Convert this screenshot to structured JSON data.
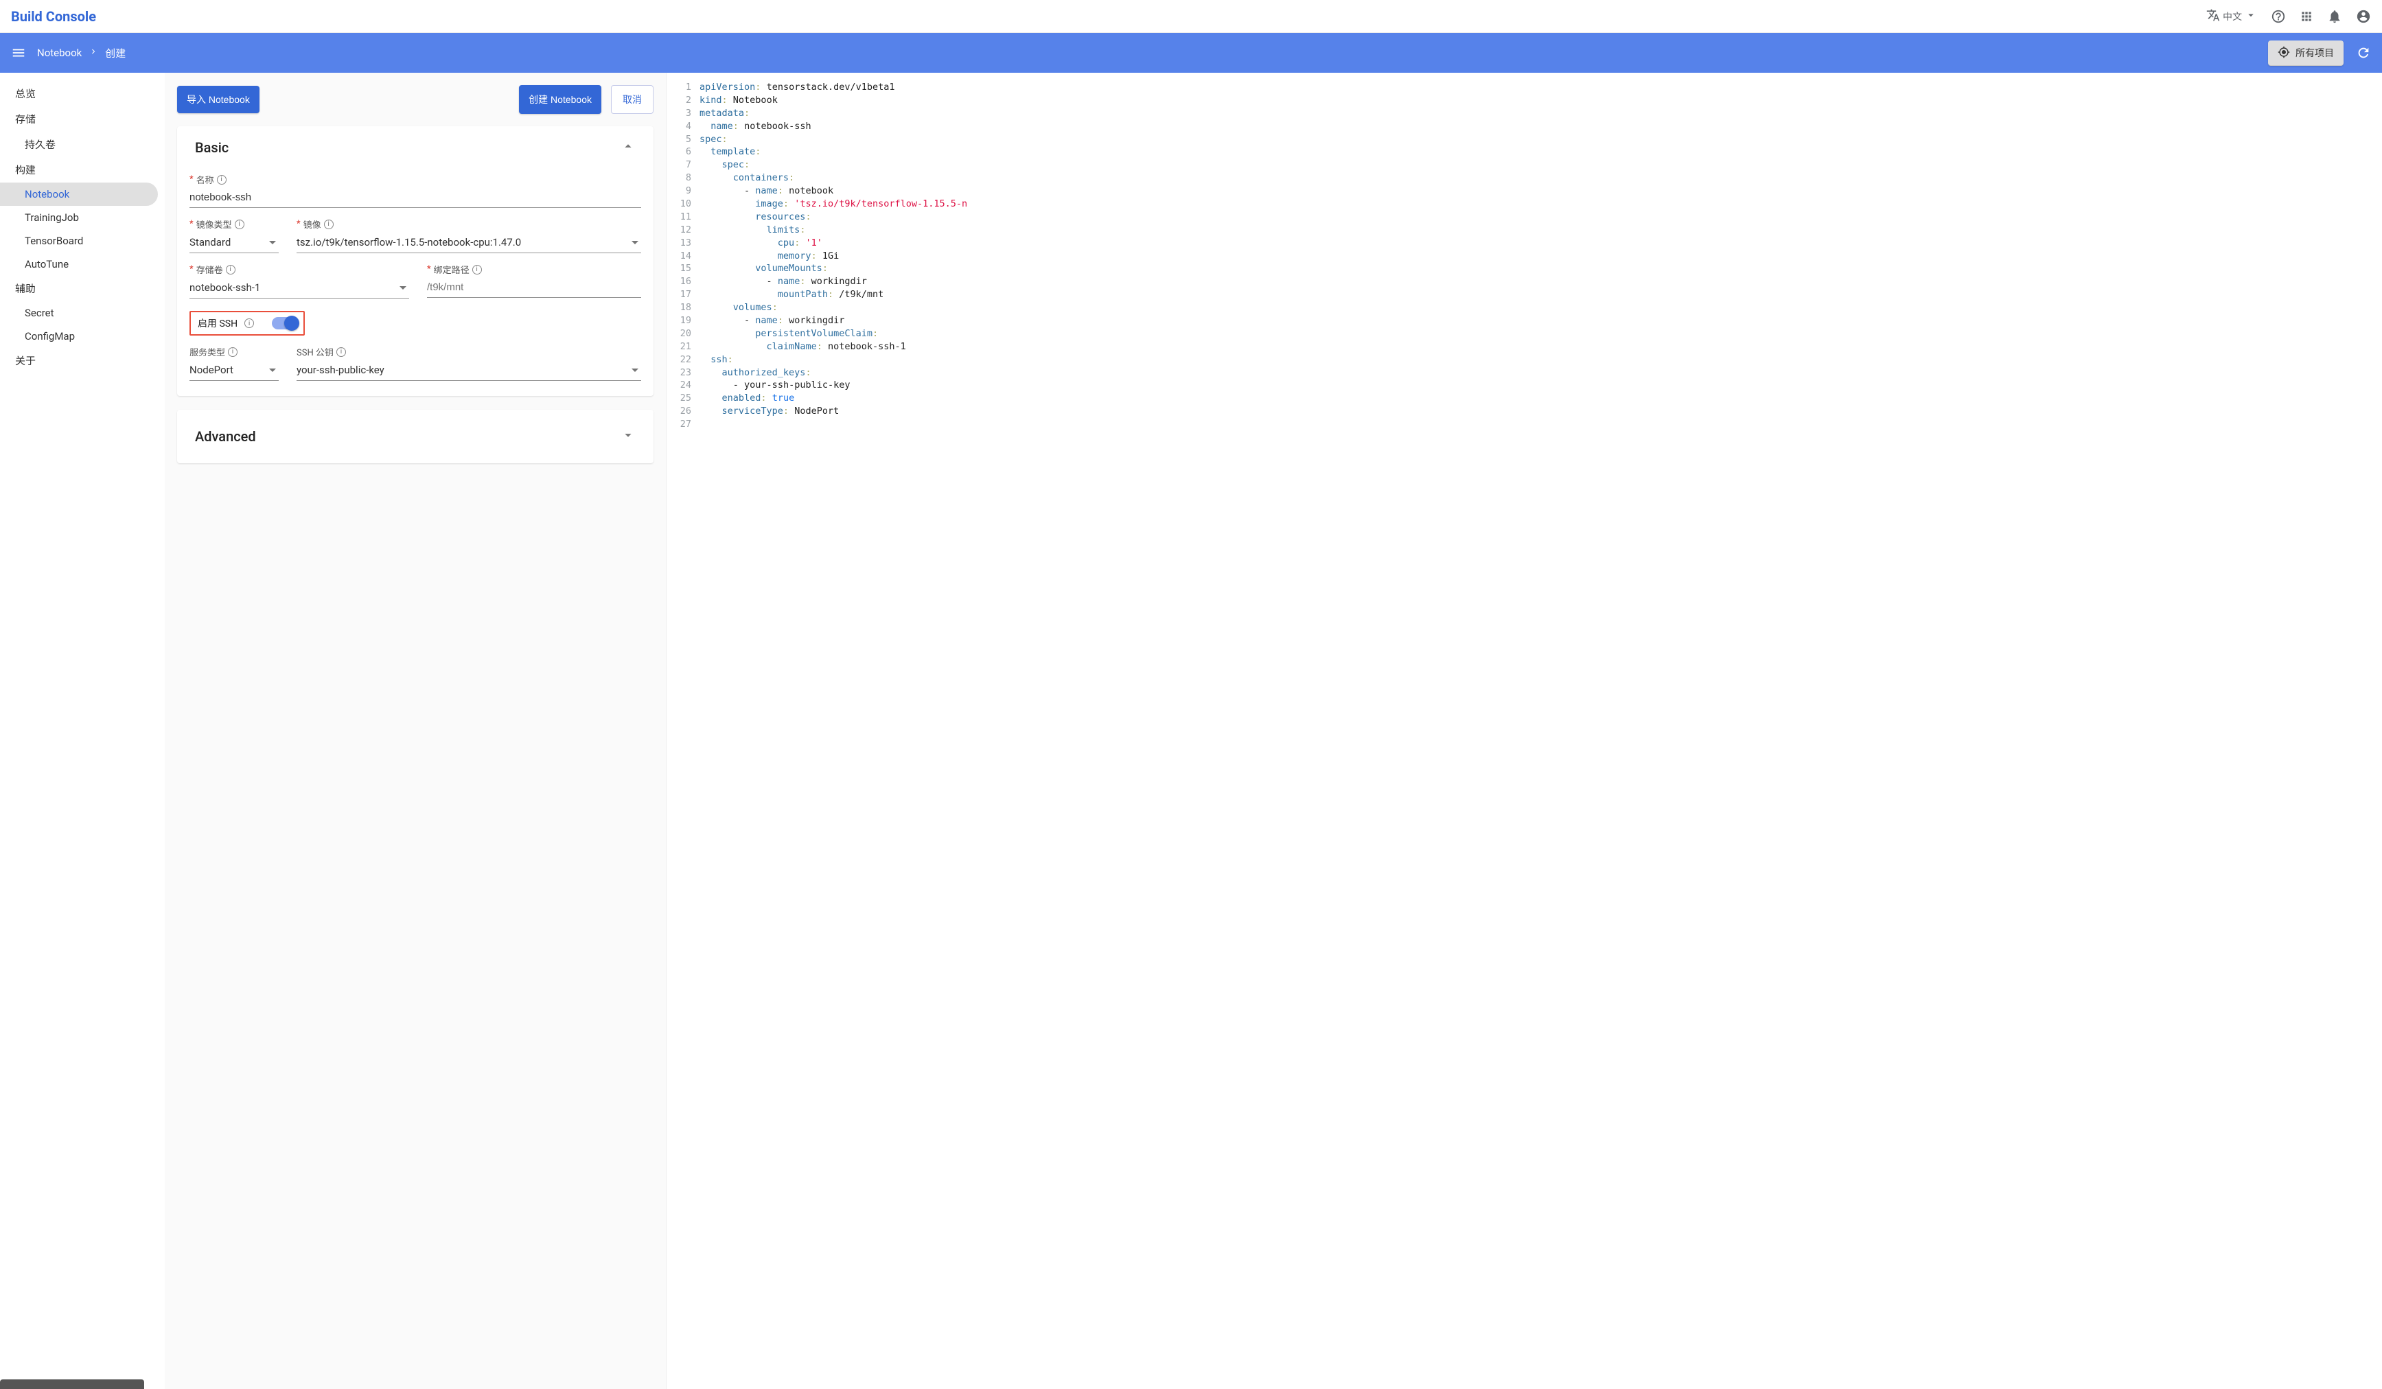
{
  "brand": "Build Console",
  "lang_label": "中文",
  "breadcrumb": {
    "a": "Notebook",
    "b": "创建"
  },
  "all_projects_label": "所有项目",
  "sidebar": {
    "overview": "总览",
    "storage": "存储",
    "pvc": "持久卷",
    "build": "构建",
    "notebook": "Notebook",
    "trainingjob": "TrainingJob",
    "tensorboard": "TensorBoard",
    "autotune": "AutoTune",
    "assist": "辅助",
    "secret": "Secret",
    "configmap": "ConfigMap",
    "about": "关于"
  },
  "actions": {
    "import": "导入 Notebook",
    "create": "创建 Notebook",
    "cancel": "取消"
  },
  "basic": {
    "title": "Basic",
    "name_label": "名称",
    "name_value": "notebook-ssh",
    "image_type_label": "镜像类型",
    "image_type_value": "Standard",
    "image_label": "镜像",
    "image_value": "tsz.io/t9k/tensorflow-1.15.5-notebook-cpu:1.47.0",
    "volume_label": "存储卷",
    "volume_value": "notebook-ssh-1",
    "mount_label": "绑定路径",
    "mount_placeholder": "/t9k/mnt",
    "enable_ssh_label": "启用 SSH",
    "service_type_label": "服务类型",
    "service_type_value": "NodePort",
    "ssh_pubkey_label": "SSH 公钥",
    "ssh_pubkey_value": "your-ssh-public-key"
  },
  "advanced": {
    "title": "Advanced"
  },
  "yaml": {
    "lines": [
      [
        [
          "key",
          "apiVersion"
        ],
        [
          "p",
          ":"
        ],
        [
          "s",
          " "
        ],
        [
          "plain",
          "tensorstack.dev/v1beta1"
        ]
      ],
      [
        [
          "key",
          "kind"
        ],
        [
          "p",
          ":"
        ],
        [
          "s",
          " "
        ],
        [
          "plain",
          "Notebook"
        ]
      ],
      [
        [
          "key",
          "metadata"
        ],
        [
          "p",
          ":"
        ]
      ],
      [
        [
          "i",
          "  "
        ],
        [
          "key",
          "name"
        ],
        [
          "p",
          ":"
        ],
        [
          "s",
          " "
        ],
        [
          "plain",
          "notebook-ssh"
        ]
      ],
      [
        [
          "key",
          "spec"
        ],
        [
          "p",
          ":"
        ]
      ],
      [
        [
          "i",
          "  "
        ],
        [
          "key",
          "template"
        ],
        [
          "p",
          ":"
        ]
      ],
      [
        [
          "i",
          "    "
        ],
        [
          "key",
          "spec"
        ],
        [
          "p",
          ":"
        ]
      ],
      [
        [
          "i",
          "      "
        ],
        [
          "key",
          "containers"
        ],
        [
          "p",
          ":"
        ]
      ],
      [
        [
          "i",
          "        "
        ],
        [
          "plain",
          "- "
        ],
        [
          "key",
          "name"
        ],
        [
          "p",
          ":"
        ],
        [
          "s",
          " "
        ],
        [
          "plain",
          "notebook"
        ]
      ],
      [
        [
          "i",
          "          "
        ],
        [
          "key",
          "image"
        ],
        [
          "p",
          ":"
        ],
        [
          "s",
          " "
        ],
        [
          "str",
          "'tsz.io/t9k/tensorflow-1.15.5-n"
        ]
      ],
      [
        [
          "i",
          "          "
        ],
        [
          "key",
          "resources"
        ],
        [
          "p",
          ":"
        ]
      ],
      [
        [
          "i",
          "            "
        ],
        [
          "key",
          "limits"
        ],
        [
          "p",
          ":"
        ]
      ],
      [
        [
          "i",
          "              "
        ],
        [
          "key",
          "cpu"
        ],
        [
          "p",
          ":"
        ],
        [
          "s",
          " "
        ],
        [
          "str",
          "'1'"
        ]
      ],
      [
        [
          "i",
          "              "
        ],
        [
          "key",
          "memory"
        ],
        [
          "p",
          ":"
        ],
        [
          "s",
          " "
        ],
        [
          "plain",
          "1Gi"
        ]
      ],
      [
        [
          "i",
          "          "
        ],
        [
          "key",
          "volumeMounts"
        ],
        [
          "p",
          ":"
        ]
      ],
      [
        [
          "i",
          "            "
        ],
        [
          "plain",
          "- "
        ],
        [
          "key",
          "name"
        ],
        [
          "p",
          ":"
        ],
        [
          "s",
          " "
        ],
        [
          "plain",
          "workingdir"
        ]
      ],
      [
        [
          "i",
          "              "
        ],
        [
          "key",
          "mountPath"
        ],
        [
          "p",
          ":"
        ],
        [
          "s",
          " "
        ],
        [
          "plain",
          "/t9k/mnt"
        ]
      ],
      [
        [
          "i",
          "      "
        ],
        [
          "key",
          "volumes"
        ],
        [
          "p",
          ":"
        ]
      ],
      [
        [
          "i",
          "        "
        ],
        [
          "plain",
          "- "
        ],
        [
          "key",
          "name"
        ],
        [
          "p",
          ":"
        ],
        [
          "s",
          " "
        ],
        [
          "plain",
          "workingdir"
        ]
      ],
      [
        [
          "i",
          "          "
        ],
        [
          "key",
          "persistentVolumeClaim"
        ],
        [
          "p",
          ":"
        ]
      ],
      [
        [
          "i",
          "            "
        ],
        [
          "key",
          "claimName"
        ],
        [
          "p",
          ":"
        ],
        [
          "s",
          " "
        ],
        [
          "plain",
          "notebook-ssh-1"
        ]
      ],
      [
        [
          "i",
          "  "
        ],
        [
          "key",
          "ssh"
        ],
        [
          "p",
          ":"
        ]
      ],
      [
        [
          "i",
          "    "
        ],
        [
          "key",
          "authorized_keys"
        ],
        [
          "p",
          ":"
        ]
      ],
      [
        [
          "i",
          "      "
        ],
        [
          "plain",
          "- "
        ],
        [
          "plain",
          "your-ssh-public-key"
        ]
      ],
      [
        [
          "i",
          "    "
        ],
        [
          "key",
          "enabled"
        ],
        [
          "p",
          ":"
        ],
        [
          "s",
          " "
        ],
        [
          "kw",
          "true"
        ]
      ],
      [
        [
          "i",
          "    "
        ],
        [
          "key",
          "serviceType"
        ],
        [
          "p",
          ":"
        ],
        [
          "s",
          " "
        ],
        [
          "plain",
          "NodePort"
        ]
      ],
      []
    ]
  }
}
